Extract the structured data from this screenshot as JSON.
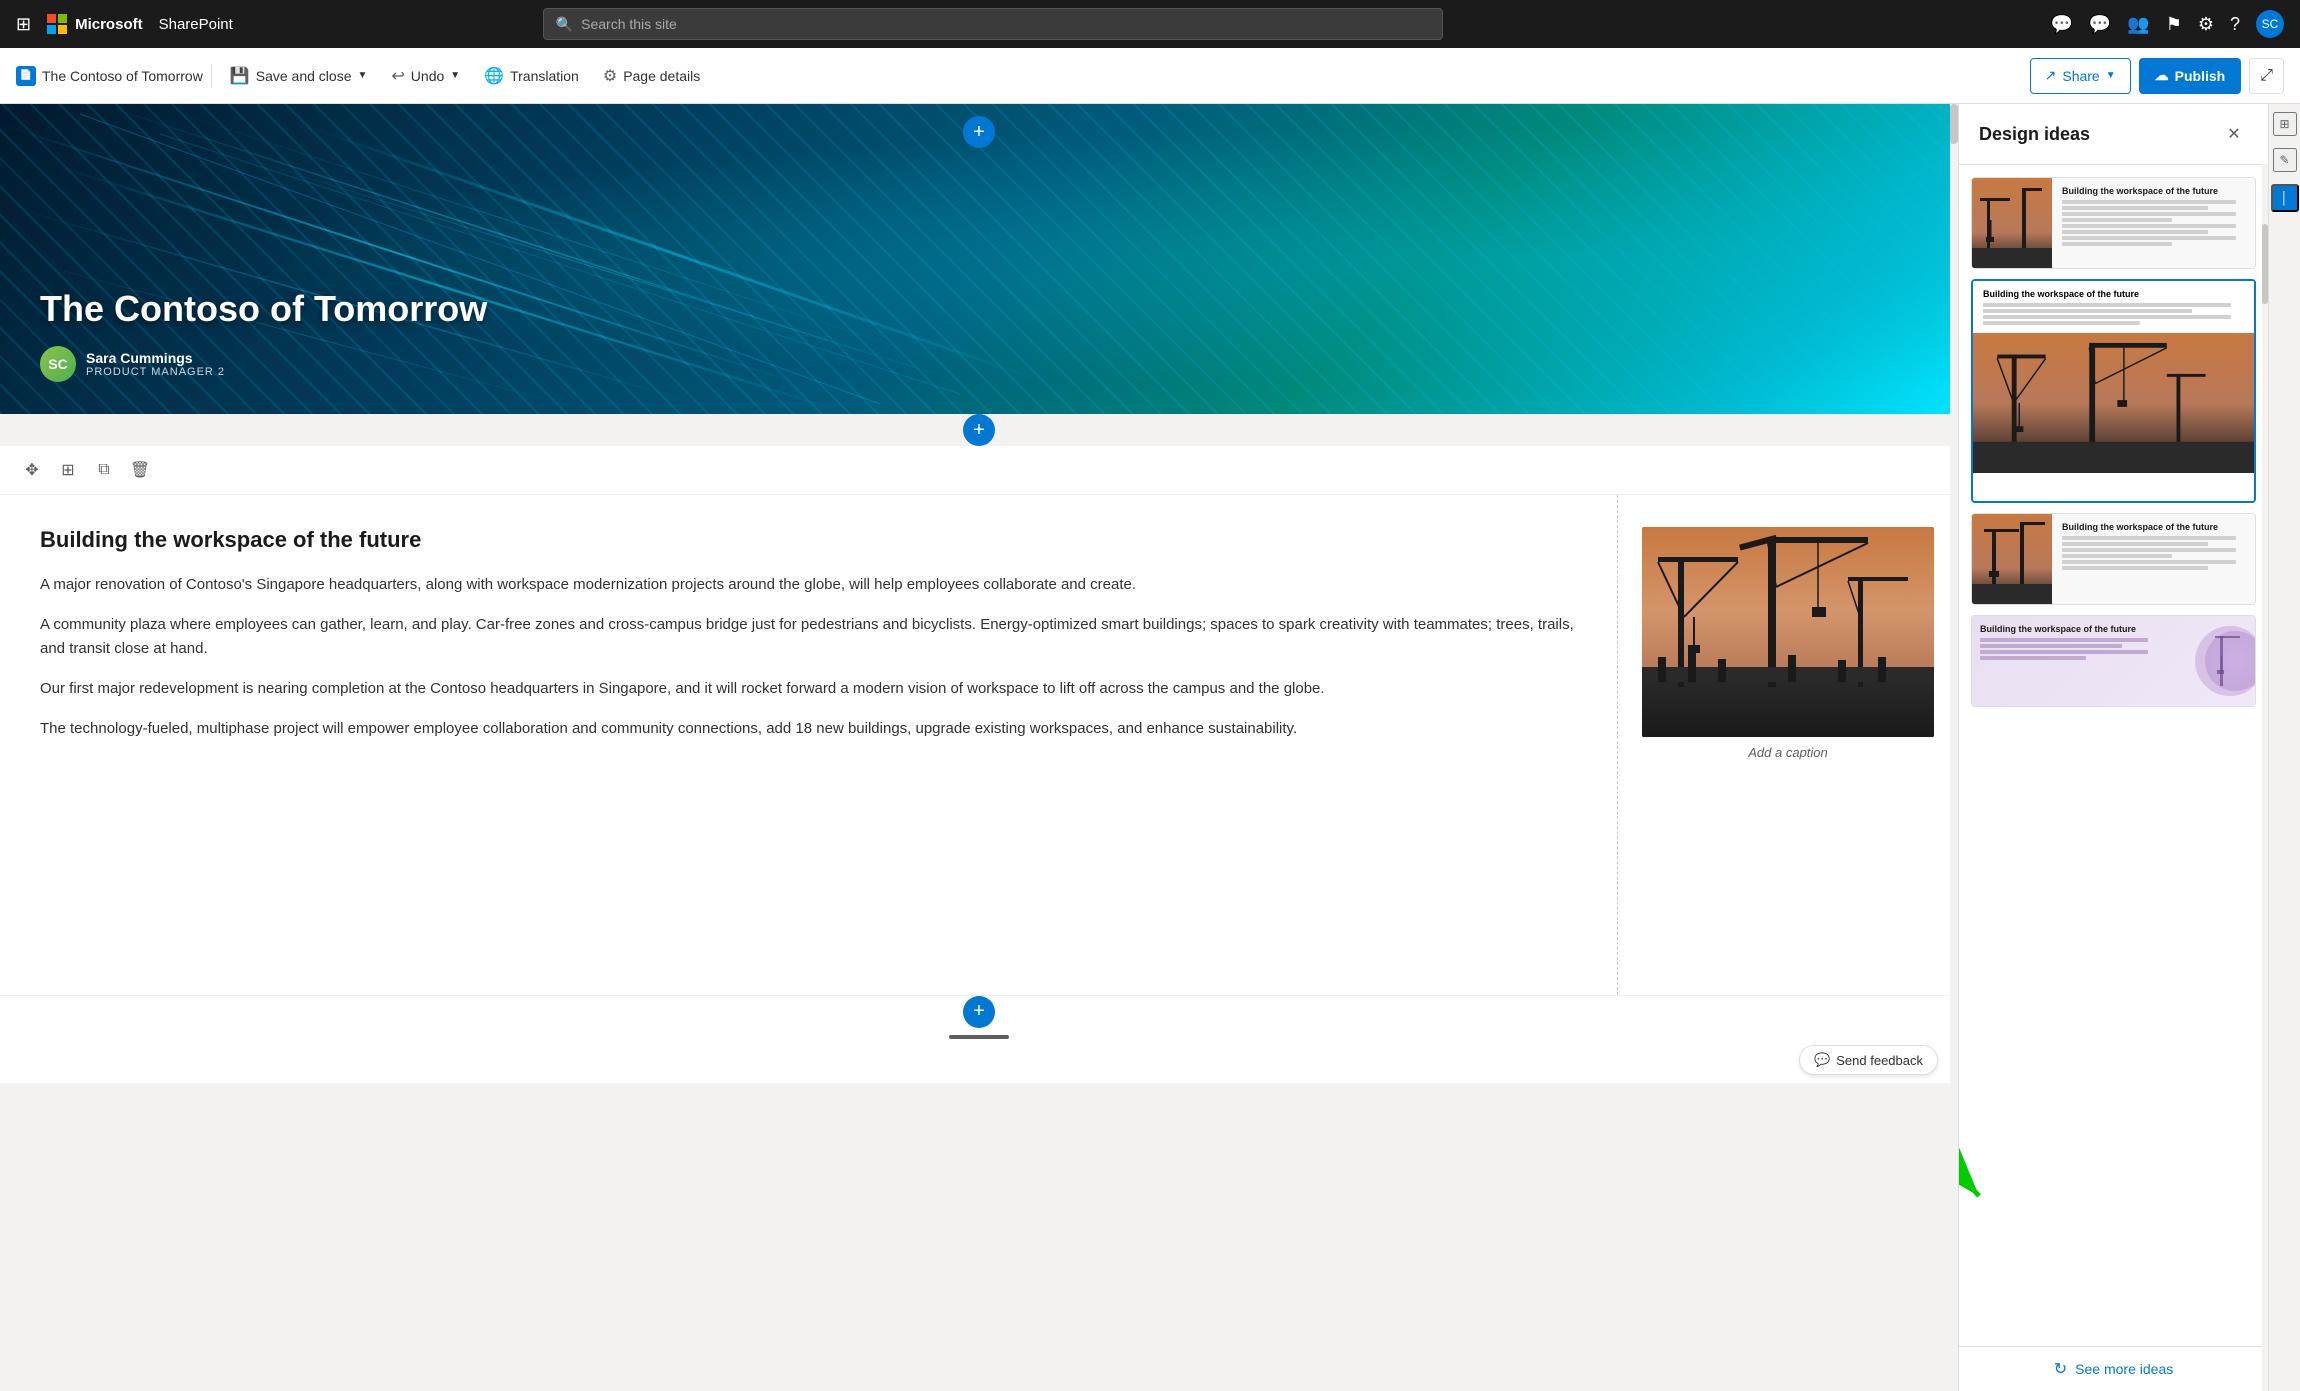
{
  "app": {
    "name": "Microsoft",
    "product": "SharePoint"
  },
  "topnav": {
    "search_placeholder": "Search this site",
    "icons": [
      "apps",
      "microphone",
      "chat",
      "people",
      "flag",
      "settings",
      "help",
      "avatar"
    ]
  },
  "toolbar": {
    "page_name": "The Contoso of Tomorrow",
    "save_close_label": "Save and close",
    "undo_label": "Undo",
    "translation_label": "Translation",
    "page_details_label": "Page details",
    "share_label": "Share",
    "publish_label": "Publish"
  },
  "hero": {
    "title": "The Contoso of Tomorrow",
    "author_name": "Sara Cummings",
    "author_role": "PRODUCT MANAGER 2",
    "author_initials": "SC"
  },
  "content": {
    "section_heading": "Building the workspace of the future",
    "paragraphs": [
      "A major renovation of Contoso's Singapore headquarters, along with workspace modernization projects around the globe, will help employees collaborate and create.",
      "A community plaza where employees can gather, learn, and play. Car-free zones and cross-campus bridge just for pedestrians and bicyclists. Energy-optimized smart buildings; spaces to spark creativity with teammates; trees, trails, and transit close at hand.",
      "Our first major redevelopment is nearing completion at the Contoso headquarters in Singapore, and it will rocket forward a modern vision of workspace to lift off across the campus and the globe.",
      "The technology-fueled, multiphase project will empower employee collaboration and community connections, add 18 new buildings, upgrade existing workspaces, and enhance sustainability."
    ],
    "image_caption": "Add a caption"
  },
  "design_panel": {
    "title": "Design ideas",
    "cards": [
      {
        "type": "split",
        "title": "Building the workspace of the future"
      },
      {
        "type": "large",
        "title": "Building the workspace of the future"
      },
      {
        "type": "split2",
        "title": "Building the workspace of the future"
      },
      {
        "type": "purple",
        "title": "Building the workspace of the future"
      }
    ],
    "see_more_label": "See more ideas",
    "send_feedback_label": "Send feedback",
    "refresh_icon": "↻"
  },
  "feedback": {
    "label": "Send feedback"
  }
}
